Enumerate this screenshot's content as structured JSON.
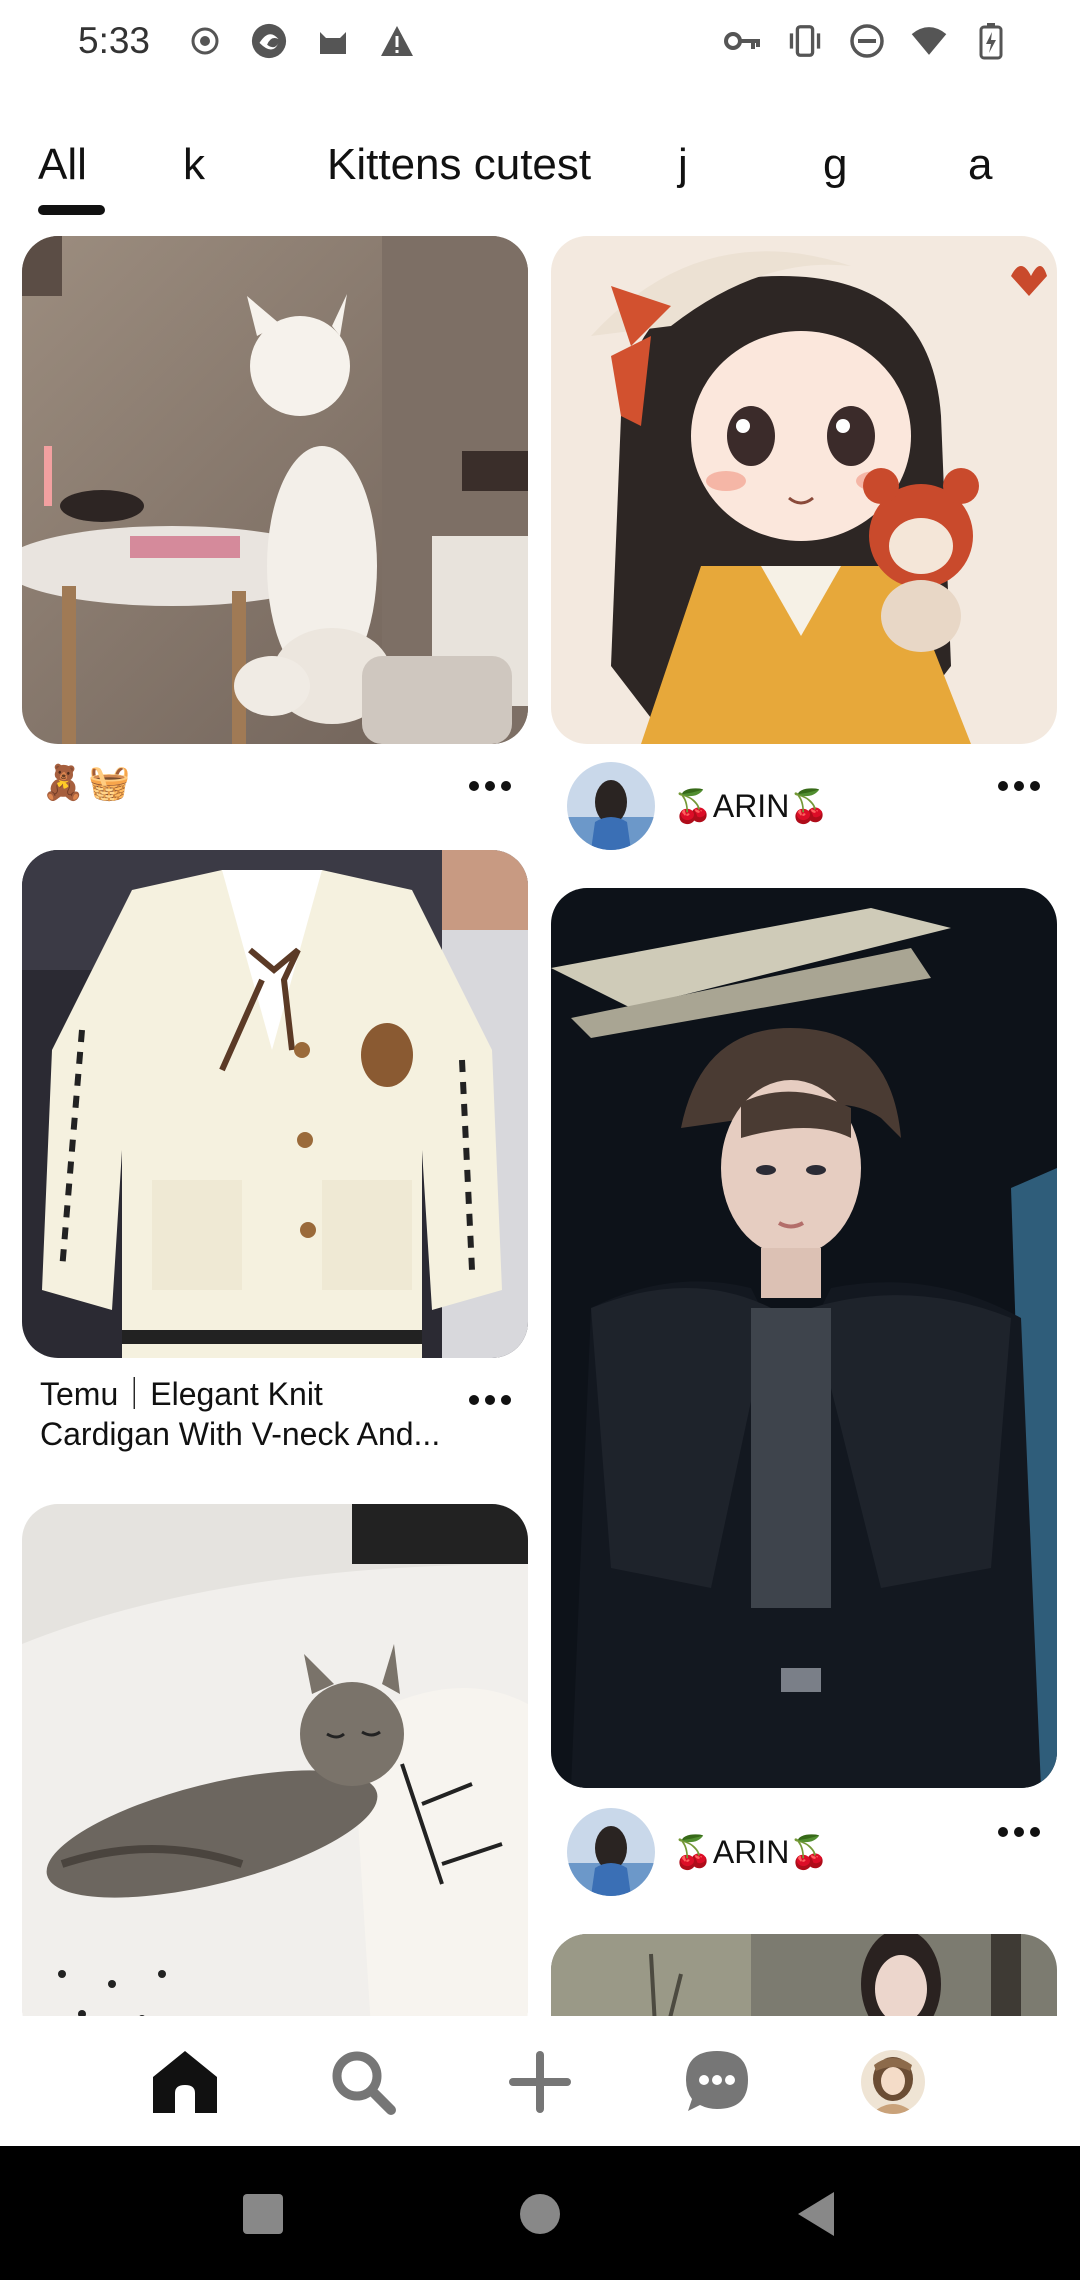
{
  "status_bar": {
    "time": "5:33",
    "left_icons": [
      "record-icon",
      "vpn-swirl-icon",
      "cat-app-icon",
      "warning-icon"
    ],
    "right_icons": [
      "key-icon",
      "vibrate-icon",
      "do-not-disturb-icon",
      "wifi-icon",
      "battery-charging-icon"
    ]
  },
  "tabs": [
    {
      "label": "All",
      "selected": true
    },
    {
      "label": "k",
      "selected": false
    },
    {
      "label": "Kittens cutest",
      "selected": false
    },
    {
      "label": "j",
      "selected": false
    },
    {
      "label": "g",
      "selected": false
    },
    {
      "label": "a",
      "selected": false
    }
  ],
  "feed": {
    "left_column": [
      {
        "image": "white-cat-on-table",
        "caption_emoji": "🧸🧺",
        "has_more": true
      },
      {
        "image": "cream-knit-cardigan",
        "title": "Temu｜Elegant Knit Cardigan With V-neck And...",
        "has_more": true
      },
      {
        "image": "sleeping-tabby-kitten"
      }
    ],
    "right_column": [
      {
        "image": "anime-girl-with-teddy",
        "author": "🍒ARIN🍒",
        "has_more": true
      },
      {
        "image": "man-in-black-jacket",
        "author": "🍒ARIN🍒",
        "has_more": true
      },
      {
        "image": "woman-in-garden"
      }
    ]
  },
  "bottom_nav": [
    {
      "name": "home",
      "icon": "home-icon",
      "active": true
    },
    {
      "name": "search",
      "icon": "search-icon",
      "active": false
    },
    {
      "name": "create",
      "icon": "plus-icon",
      "active": false
    },
    {
      "name": "messages",
      "icon": "chat-icon",
      "active": false
    },
    {
      "name": "profile",
      "icon": "avatar-icon",
      "active": false
    }
  ],
  "system_nav": [
    "recents-button",
    "home-button",
    "back-button"
  ],
  "colors": {
    "text": "#111111",
    "status_icons": "#555555",
    "nav_icons": "#767676",
    "system_bar": "#000000"
  }
}
